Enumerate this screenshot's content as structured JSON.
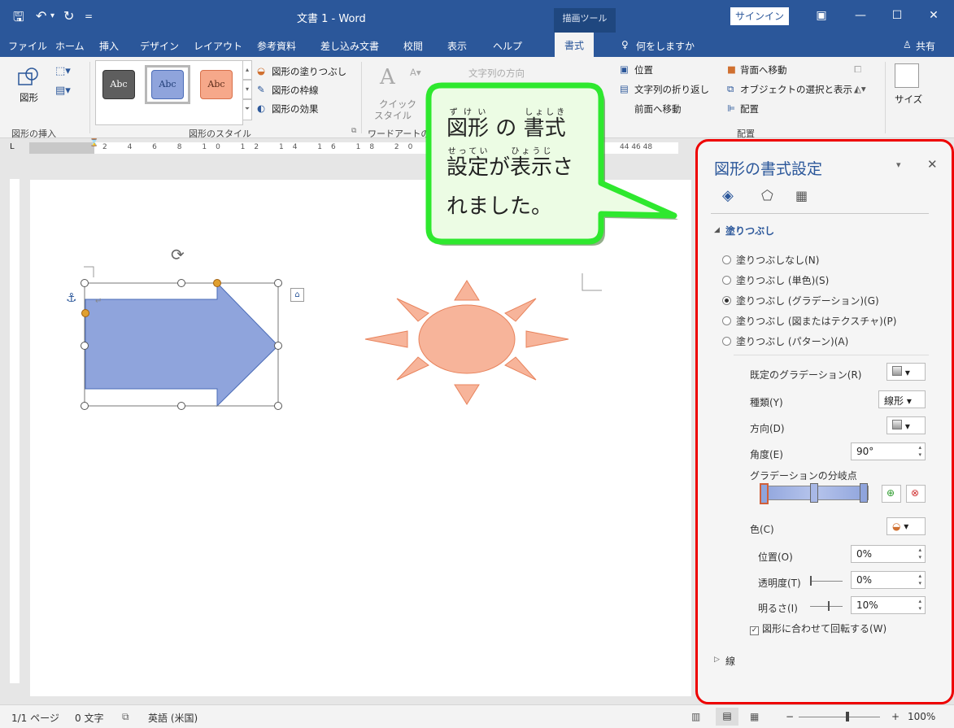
{
  "titlebar": {
    "title": "文書 1 - Word",
    "context_tab": "描画ツール",
    "signin": "サインイン"
  },
  "tabs": [
    "ファイル",
    "ホーム",
    "挿入",
    "デザイン",
    "レイアウト",
    "参考資料",
    "差し込み文書",
    "校閲",
    "表示",
    "ヘルプ",
    "書式"
  ],
  "tell_me": "何をしますか",
  "share": "共有",
  "ribbon": {
    "insert_shape_label": "図形",
    "group_insert": "図形の挿入",
    "style_sample": "Abc",
    "shape_fill": "図形の塗りつぶし",
    "shape_outline": "図形の枠線",
    "shape_effects": "図形の効果",
    "group_styles": "図形のスタイル",
    "quick_style": "クイック",
    "quick_style2": "スタイル",
    "text_direction": "文字列の方向",
    "group_wordart": "ワードアートの",
    "position": "位置",
    "wrap_text": "文字列の折り返し",
    "bring_forward": "前面へ移動",
    "send_backward": "背面へ移動",
    "selection_pane": "オブジェクトの選択と表示",
    "align": "配置",
    "group_arrange": "配置",
    "size": "サイズ",
    "ruler_right": "44  46  48"
  },
  "callout": {
    "zukei": "図形",
    "zukei_ruby": "ずけい",
    "no": "の",
    "shoshiki": "書式",
    "shoshiki_ruby": "しょしき",
    "settei": "設定",
    "settei_ruby": "せってい",
    "ga": "が",
    "hyouji": "表示",
    "hyouji_ruby": "ひょうじ",
    "sa": "さ",
    "line3": "れました。"
  },
  "pane": {
    "title": "図形の書式設定",
    "section_fill": "塗りつぶし",
    "fill_options": [
      {
        "label": "塗りつぶしなし(N)",
        "selected": false
      },
      {
        "label": "塗りつぶし (単色)(S)",
        "selected": false
      },
      {
        "label": "塗りつぶし (グラデーション)(G)",
        "selected": true
      },
      {
        "label": "塗りつぶし (図またはテクスチャ)(P)",
        "selected": false
      },
      {
        "label": "塗りつぶし (パターン)(A)",
        "selected": false
      }
    ],
    "preset_gradient": "既定のグラデーション(R)",
    "type_label": "種類(Y)",
    "type_value": "線形",
    "direction_label": "方向(D)",
    "angle_label": "角度(E)",
    "angle_value": "90°",
    "stops_label": "グラデーションの分岐点",
    "color_label": "色(C)",
    "position_label": "位置(O)",
    "position_value": "0%",
    "transparency_label": "透明度(T)",
    "transparency_value": "0%",
    "brightness_label": "明るさ(I)",
    "brightness_value": "10%",
    "rotate_with_shape": "図形に合わせて回転する(W)",
    "rotate_checked": true,
    "section_line": "線"
  },
  "statusbar": {
    "page": "1/1 ページ",
    "words": "0 文字",
    "language": "英語 (米国)",
    "zoom": "100%"
  },
  "colors": {
    "word_blue": "#2b579a",
    "arrow_fill": "#8fa4dc",
    "sun_fill": "#f7b49a",
    "callout_fill": "#ecfce4",
    "callout_border": "#2ee82e",
    "pane_highlight": "#e00000"
  }
}
